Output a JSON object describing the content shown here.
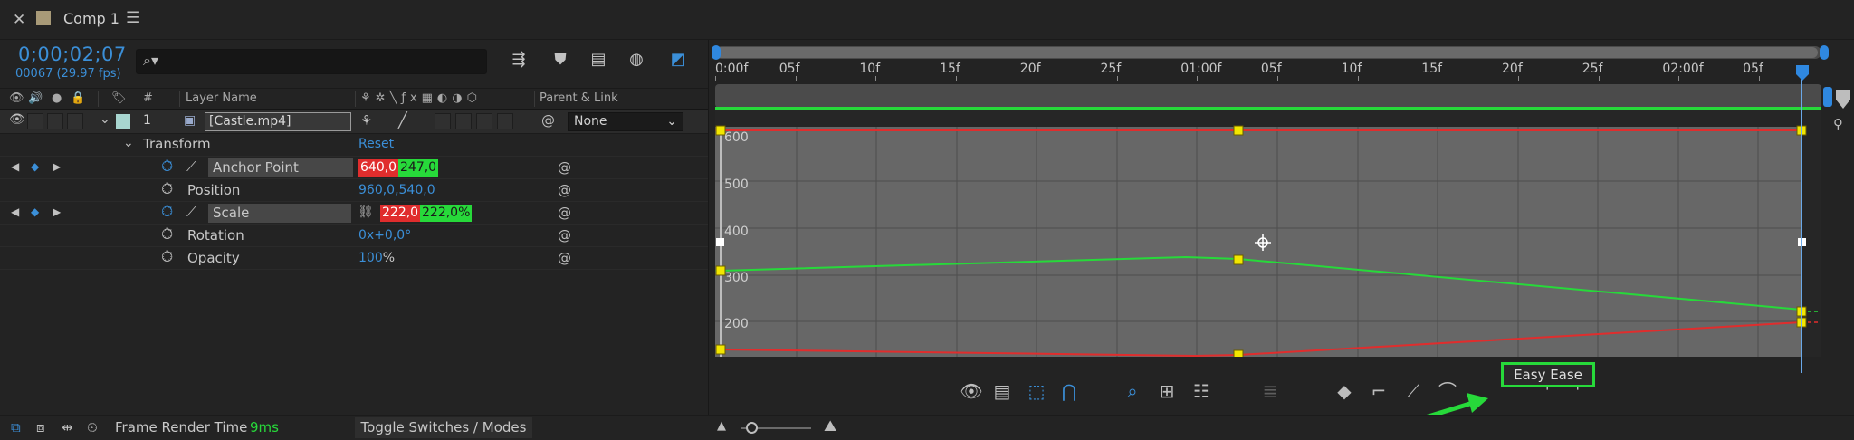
{
  "tab": {
    "title": "Comp 1"
  },
  "comp": {
    "timecode": "0;00;02;07",
    "frame_info": "00067 (29.97 fps)"
  },
  "search": {
    "placeholder": ""
  },
  "columns": {
    "hash": "#",
    "layer_name": "Layer Name",
    "parent_link": "Parent & Link"
  },
  "layer": {
    "index": "1",
    "name": "[Castle.mp4]",
    "parent": "None"
  },
  "transform": {
    "label": "Transform",
    "reset": "Reset"
  },
  "properties": [
    {
      "name": "Anchor Point",
      "v1": "640,0",
      "v2": "247,0"
    },
    {
      "name": "Position",
      "value": "960,0,540,0"
    },
    {
      "name": "Scale",
      "v1": "222,0",
      "v2": "222,0%"
    },
    {
      "name": "Rotation",
      "value": "0x+0,0°"
    },
    {
      "name": "Opacity",
      "value": "100",
      "unit": "%"
    }
  ],
  "timeline": {
    "labels": [
      "0:00f",
      "05f",
      "10f",
      "15f",
      "20f",
      "25f",
      "01:00f",
      "05f",
      "10f",
      "15f",
      "20f",
      "25f",
      "02:00f",
      "05f"
    ]
  },
  "graph": {
    "y_labels": [
      "600",
      "500",
      "400",
      "300",
      "200"
    ]
  },
  "footer": {
    "frame_render_label": "Frame Render Time",
    "frame_render_value": "9ms",
    "toggle_label": "Toggle Switches / Modes"
  },
  "tooltip": {
    "easy_ease": "Easy Ease"
  },
  "colors": {
    "accent_blue": "#3b8fd8",
    "green": "#27d93a",
    "red": "#e02d2d",
    "yellow": "#f2e600"
  }
}
